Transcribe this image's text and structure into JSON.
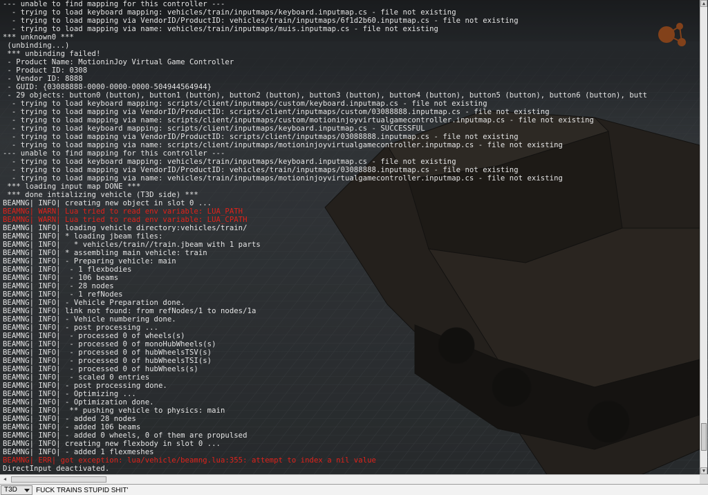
{
  "console": {
    "lines": [
      {
        "text": "--- unable to find mapping for this controller ---",
        "type": "normal"
      },
      {
        "text": "  - trying to load keyboard mapping: vehicles/train/inputmaps/keyboard.inputmap.cs - file not existing",
        "type": "normal"
      },
      {
        "text": "  - trying to load mapping via VendorID/ProductID: vehicles/train/inputmaps/6f1d2b60.inputmap.cs - file not existing",
        "type": "normal"
      },
      {
        "text": "  - trying to load mapping via name: vehicles/train/inputmaps/muis.inputmap.cs - file not existing",
        "type": "normal"
      },
      {
        "text": "*** unknown0 ***",
        "type": "normal"
      },
      {
        "text": " (unbinding...)",
        "type": "normal"
      },
      {
        "text": " *** unbinding failed!",
        "type": "normal"
      },
      {
        "text": " - Product Name: MotioninJoy Virtual Game Controller",
        "type": "normal"
      },
      {
        "text": " - Product ID: 0308",
        "type": "normal"
      },
      {
        "text": " - Vendor ID: 8888",
        "type": "normal"
      },
      {
        "text": " - GUID: {03088888-0000-0000-0000-504944564944}",
        "type": "normal"
      },
      {
        "text": " - 29 objects: button0 (button), button1 (button), button2 (button), button3 (button), button4 (button), button5 (button), button6 (button), butt",
        "type": "normal"
      },
      {
        "text": "  - trying to load keyboard mapping: scripts/client/inputmaps/custom/keyboard.inputmap.cs - file not existing",
        "type": "normal"
      },
      {
        "text": "  - trying to load mapping via VendorID/ProductID: scripts/client/inputmaps/custom/03088888.inputmap.cs - file not existing",
        "type": "normal"
      },
      {
        "text": "  - trying to load mapping via name: scripts/client/inputmaps/custom/motioninjoyvirtualgamecontroller.inputmap.cs - file not existing",
        "type": "normal"
      },
      {
        "text": "  - trying to load keyboard mapping: scripts/client/inputmaps/keyboard.inputmap.cs - SUCCESSFUL",
        "type": "normal"
      },
      {
        "text": "  - trying to load mapping via VendorID/ProductID: scripts/client/inputmaps/03088888.inputmap.cs - file not existing",
        "type": "normal"
      },
      {
        "text": "  - trying to load mapping via name: scripts/client/inputmaps/motioninjoyvirtualgamecontroller.inputmap.cs - file not existing",
        "type": "normal"
      },
      {
        "text": "--- unable to find mapping for this controller ---",
        "type": "normal"
      },
      {
        "text": "  - trying to load keyboard mapping: vehicles/train/inputmaps/keyboard.inputmap.cs - file not existing",
        "type": "normal"
      },
      {
        "text": "  - trying to load mapping via VendorID/ProductID: vehicles/train/inputmaps/03088888.inputmap.cs - file not existing",
        "type": "normal"
      },
      {
        "text": "  - trying to load mapping via name: vehicles/train/inputmaps/motioninjoyvirtualgamecontroller.inputmap.cs - file not existing",
        "type": "normal"
      },
      {
        "text": " *** loading input map DONE ***",
        "type": "normal"
      },
      {
        "text": " *** done intializing vehicle (T3D side) ***",
        "type": "normal"
      },
      {
        "text": "BEAMNG| INFO| creating new object in slot 0 ...",
        "type": "normal"
      },
      {
        "text": "BEAMNG| WARN| Lua tried to read env variable: LUA_PATH",
        "type": "error"
      },
      {
        "text": "BEAMNG| WARN| Lua tried to read env variable: LUA_CPATH",
        "type": "error"
      },
      {
        "text": "BEAMNG| INFO| loading vehicle directory:vehicles/train/",
        "type": "normal"
      },
      {
        "text": "BEAMNG| INFO| * loading jbeam files:",
        "type": "normal"
      },
      {
        "text": "BEAMNG| INFO|   * vehicles/train//train.jbeam with 1 parts",
        "type": "normal"
      },
      {
        "text": "BEAMNG| INFO| * assembling main vehicle: train",
        "type": "normal"
      },
      {
        "text": "BEAMNG| INFO| - Preparing vehicle: main",
        "type": "normal"
      },
      {
        "text": "BEAMNG| INFO|  - 1 flexbodies",
        "type": "normal"
      },
      {
        "text": "BEAMNG| INFO|  - 106 beams",
        "type": "normal"
      },
      {
        "text": "BEAMNG| INFO|  - 28 nodes",
        "type": "normal"
      },
      {
        "text": "BEAMNG| INFO|  - 1 refNodes",
        "type": "normal"
      },
      {
        "text": "BEAMNG| INFO| - Vehicle Preparation done.",
        "type": "normal"
      },
      {
        "text": "BEAMNG| INFO| link not found: from refNodes/1 to nodes/1a",
        "type": "normal"
      },
      {
        "text": "BEAMNG| INFO| - Vehicle numbering done.",
        "type": "normal"
      },
      {
        "text": "BEAMNG| INFO| - post processing ...",
        "type": "normal"
      },
      {
        "text": "BEAMNG| INFO|  - processed 0 of wheels(s)",
        "type": "normal"
      },
      {
        "text": "BEAMNG| INFO|  - processed 0 of monoHubWheels(s)",
        "type": "normal"
      },
      {
        "text": "BEAMNG| INFO|  - processed 0 of hubWheelsTSV(s)",
        "type": "normal"
      },
      {
        "text": "BEAMNG| INFO|  - processed 0 of hubWheelsTSI(s)",
        "type": "normal"
      },
      {
        "text": "BEAMNG| INFO|  - processed 0 of hubWheels(s)",
        "type": "normal"
      },
      {
        "text": "BEAMNG| INFO|  - scaled 0 entries",
        "type": "normal"
      },
      {
        "text": "BEAMNG| INFO| - post processing done.",
        "type": "normal"
      },
      {
        "text": "BEAMNG| INFO| - Optimizing ...",
        "type": "normal"
      },
      {
        "text": "BEAMNG| INFO| - Optimization done.",
        "type": "normal"
      },
      {
        "text": "BEAMNG| INFO|  ** pushing vehicle to physics: main",
        "type": "normal"
      },
      {
        "text": "BEAMNG| INFO| - added 28 nodes",
        "type": "normal"
      },
      {
        "text": "BEAMNG| INFO| - added 106 beams",
        "type": "normal"
      },
      {
        "text": "BEAMNG| INFO| - added 0 wheels, 0 of them are propulsed",
        "type": "normal"
      },
      {
        "text": "BEAMNG| INFO| creating new flexbody in slot 0 ...",
        "type": "normal"
      },
      {
        "text": "BEAMNG| INFO| - added 1 flexmeshes",
        "type": "normal"
      },
      {
        "text": "BEAMNG| ERR| got exception: lua/vehicle/beamng.lua:355: attempt to index a nil value",
        "type": "error"
      },
      {
        "text": "DirectInput deactivated.",
        "type": "normal"
      }
    ]
  },
  "command_bar": {
    "mode_label": "T3D",
    "input_value": "FUCK TRAINS STUPID SHIT'"
  },
  "colors": {
    "error": "#e0221a",
    "text": "#e4e4e4"
  }
}
